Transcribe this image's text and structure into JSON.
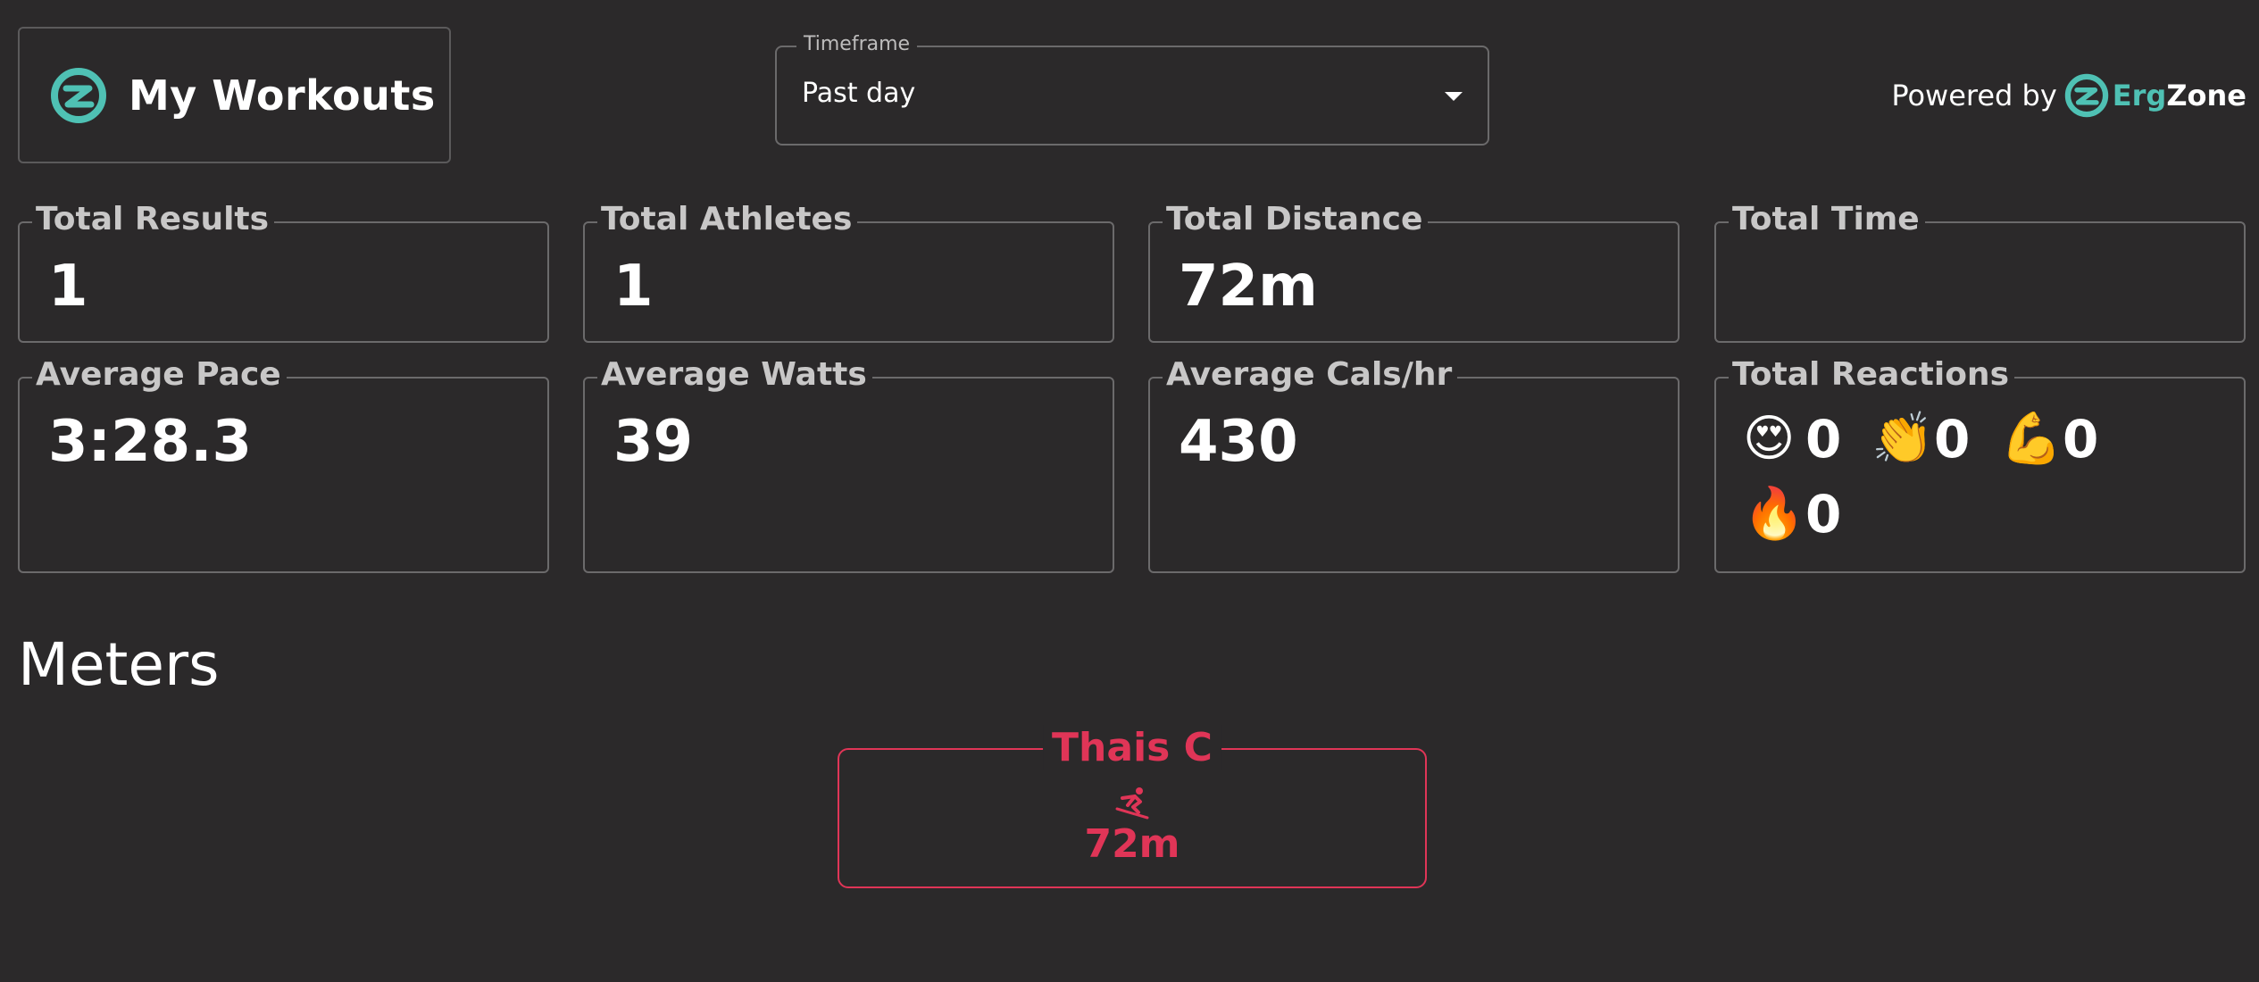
{
  "header": {
    "brand_title": "My Workouts",
    "timeframe": {
      "label": "Timeframe",
      "value": "Past day"
    },
    "powered_by": {
      "prefix": "Powered by",
      "brand_part1": "Erg",
      "brand_part2": "Zone"
    }
  },
  "stats": {
    "total_results": {
      "label": "Total Results",
      "value": "1"
    },
    "total_athletes": {
      "label": "Total Athletes",
      "value": "1"
    },
    "total_distance": {
      "label": "Total Distance",
      "value": "72m"
    },
    "total_time": {
      "label": "Total Time",
      "value": ""
    },
    "average_pace": {
      "label": "Average Pace",
      "value": "3:28.3"
    },
    "average_watts": {
      "label": "Average Watts",
      "value": "39"
    },
    "average_cals": {
      "label": "Average Cals/hr",
      "value": "430"
    },
    "total_reactions": {
      "label": "Total Reactions",
      "items": [
        {
          "emoji": "😍",
          "count": "0"
        },
        {
          "emoji": "👏",
          "count": "0"
        },
        {
          "emoji": "💪",
          "count": "0"
        },
        {
          "emoji": "🔥",
          "count": "0"
        }
      ]
    }
  },
  "meters_section": {
    "title": "Meters",
    "athletes": [
      {
        "name": "Thais C",
        "icon": "skier-icon",
        "meters": "72m"
      }
    ]
  },
  "colors": {
    "background": "#2b292a",
    "accent_teal": "#4fc1b4",
    "athlete_red": "#e03557",
    "border": "#6b6a6b"
  }
}
